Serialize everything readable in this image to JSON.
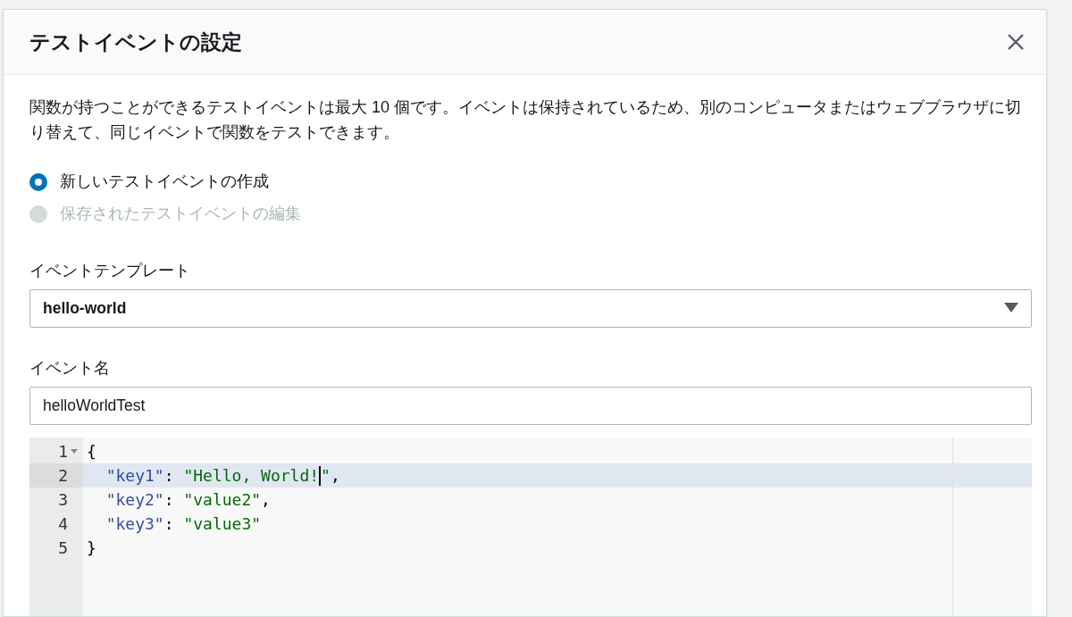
{
  "dialog": {
    "title": "テストイベントの設定",
    "description": "関数が持つことができるテストイベントは最大 10 個です。イベントは保持されているため、別のコンピュータまたはウェブブラウザに切り替えて、同じイベントで関数をテストできます。",
    "options": [
      {
        "label": "新しいテストイベントの作成",
        "selected": true,
        "disabled": false
      },
      {
        "label": "保存されたテストイベントの編集",
        "selected": false,
        "disabled": true
      }
    ],
    "template": {
      "label": "イベントテンプレート",
      "value": "hello-world"
    },
    "event_name": {
      "label": "イベント名",
      "value": "helloWorldTest"
    },
    "editor": {
      "lines": [
        {
          "number": "1",
          "foldable": true,
          "active": false,
          "tokens": [
            {
              "kind": "punct",
              "text": "{"
            }
          ]
        },
        {
          "number": "2",
          "foldable": false,
          "active": true,
          "tokens": [
            {
              "kind": "key",
              "text": "  \"key1\""
            },
            {
              "kind": "punct",
              "text": ": "
            },
            {
              "kind": "string",
              "text": "\"Hello, World!",
              "cursor_after": true
            },
            {
              "kind": "string",
              "text": "\""
            },
            {
              "kind": "punct",
              "text": ","
            }
          ]
        },
        {
          "number": "3",
          "foldable": false,
          "active": false,
          "tokens": [
            {
              "kind": "key",
              "text": "  \"key2\""
            },
            {
              "kind": "punct",
              "text": ": "
            },
            {
              "kind": "string",
              "text": "\"value2\""
            },
            {
              "kind": "punct",
              "text": ","
            }
          ]
        },
        {
          "number": "4",
          "foldable": false,
          "active": false,
          "tokens": [
            {
              "kind": "key",
              "text": "  \"key3\""
            },
            {
              "kind": "punct",
              "text": ": "
            },
            {
              "kind": "string",
              "text": "\"value3\""
            }
          ]
        },
        {
          "number": "5",
          "foldable": false,
          "active": false,
          "tokens": [
            {
              "kind": "punct",
              "text": "}"
            }
          ]
        }
      ]
    }
  }
}
